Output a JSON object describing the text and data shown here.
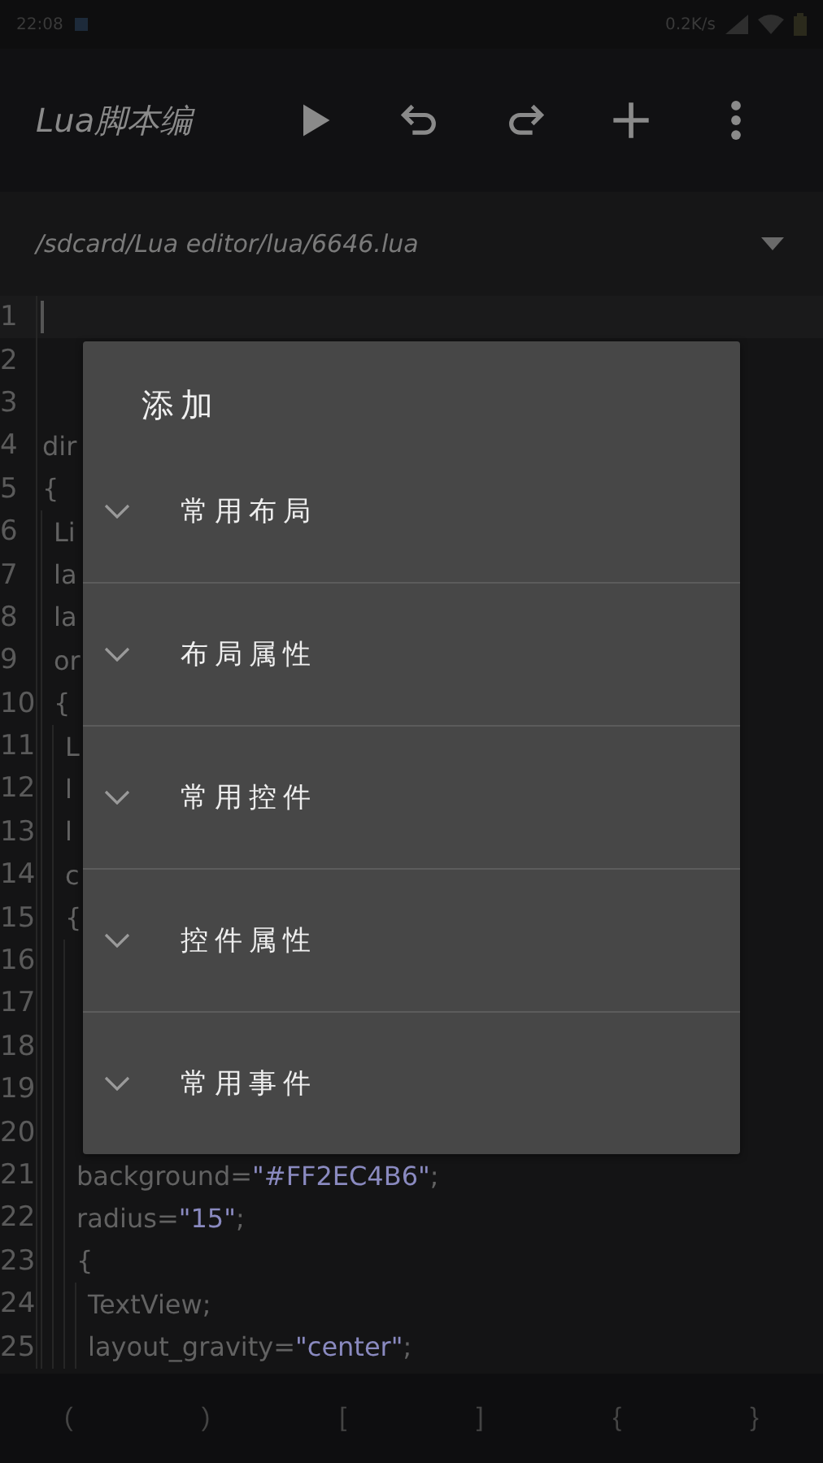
{
  "status_bar": {
    "time": "22:08",
    "speed": "0.2K/s"
  },
  "toolbar": {
    "title": "Lua脚本编",
    "actions": [
      {
        "kind": "play"
      },
      {
        "kind": "undo"
      },
      {
        "kind": "redo"
      },
      {
        "kind": "add"
      },
      {
        "kind": "more"
      }
    ]
  },
  "path_bar": {
    "path": "/sdcard/Lua editor/lua/6646.lua"
  },
  "editor": {
    "lines": [
      {
        "number": "1",
        "current": true
      },
      {
        "number": "2",
        "current": false
      },
      {
        "number": "3",
        "current": false
      },
      {
        "number": "4",
        "current": false,
        "parts": [
          {
            "kind": "plain",
            "text": "dir"
          }
        ]
      },
      {
        "number": "5",
        "current": false,
        "parts": [
          {
            "kind": "plain",
            "text": "{"
          }
        ],
        "children": [
          {
            "number": "6",
            "current": false,
            "parts": [
              {
                "kind": "plain",
                "text": "Li"
              }
            ]
          },
          {
            "number": "7",
            "current": false,
            "parts": [
              {
                "kind": "plain",
                "text": "la"
              }
            ]
          },
          {
            "number": "8",
            "current": false,
            "parts": [
              {
                "kind": "plain",
                "text": "la"
              }
            ]
          },
          {
            "number": "9",
            "current": false,
            "parts": [
              {
                "kind": "plain",
                "text": "or"
              }
            ]
          },
          {
            "number": "10",
            "current": false,
            "parts": [
              {
                "kind": "plain",
                "text": "{"
              }
            ],
            "children": [
              {
                "number": "11",
                "current": false,
                "parts": [
                  {
                    "kind": "plain",
                    "text": "L"
                  }
                ]
              },
              {
                "number": "12",
                "current": false,
                "parts": [
                  {
                    "kind": "plain",
                    "text": "l"
                  }
                ]
              },
              {
                "number": "13",
                "current": false,
                "parts": [
                  {
                    "kind": "plain",
                    "text": "l"
                  }
                ]
              },
              {
                "number": "14",
                "current": false,
                "parts": [
                  {
                    "kind": "plain",
                    "text": "c"
                  }
                ]
              },
              {
                "number": "15",
                "current": false,
                "parts": [
                  {
                    "kind": "plain",
                    "text": "{"
                  }
                ],
                "children": [
                  {
                    "number": "16",
                    "current": false
                  },
                  {
                    "number": "17",
                    "current": false
                  },
                  {
                    "number": "18",
                    "current": false
                  },
                  {
                    "number": "19",
                    "current": false
                  },
                  {
                    "number": "20",
                    "current": false
                  },
                  {
                    "number": "21",
                    "current": false,
                    "parts": [
                      {
                        "kind": "plain",
                        "text": "background="
                      },
                      {
                        "kind": "string",
                        "text": "\"#FF2EC4B6\""
                      },
                      {
                        "kind": "plain",
                        "text": ";"
                      }
                    ]
                  },
                  {
                    "number": "22",
                    "current": false,
                    "parts": [
                      {
                        "kind": "plain",
                        "text": "radius="
                      },
                      {
                        "kind": "string",
                        "text": "\"15\""
                      },
                      {
                        "kind": "plain",
                        "text": ";"
                      }
                    ]
                  },
                  {
                    "number": "23",
                    "current": false,
                    "parts": [
                      {
                        "kind": "plain",
                        "text": "{"
                      }
                    ],
                    "children": [
                      {
                        "number": "24",
                        "current": false,
                        "parts": [
                          {
                            "kind": "plain",
                            "text": "TextView;"
                          }
                        ]
                      },
                      {
                        "number": "25",
                        "current": false,
                        "parts": [
                          {
                            "kind": "plain",
                            "text": "layout_gravity="
                          },
                          {
                            "kind": "string",
                            "text": "\"center\""
                          },
                          {
                            "kind": "plain",
                            "text": ";"
                          }
                        ]
                      }
                    ]
                  }
                ]
              }
            ]
          }
        ]
      }
    ]
  },
  "symbol_bar": {
    "keys": [
      "(",
      ")",
      "[",
      "]",
      "{",
      "}"
    ]
  },
  "dialog": {
    "title": "添加",
    "items": [
      {
        "label": "常用布局",
        "expanded": false
      },
      {
        "label": "布局属性",
        "expanded": false
      },
      {
        "label": "常用控件",
        "expanded": false
      },
      {
        "label": "控件属性",
        "expanded": false
      },
      {
        "label": "常用事件",
        "expanded": false
      }
    ]
  }
}
